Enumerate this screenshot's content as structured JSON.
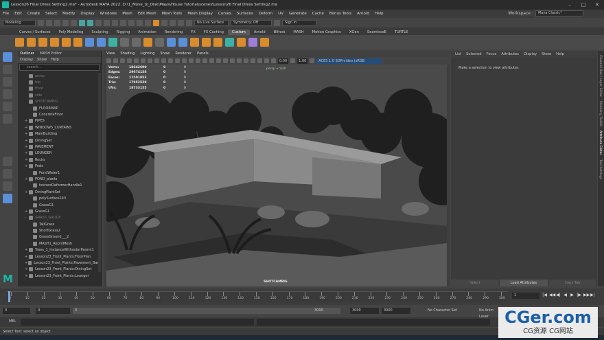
{
  "window": {
    "title": "Lesson26 Final Dress Setting2.ma* - Autodesk MAYA 2022: D:\\1_Move_to_Disk\\Maya\\House Tutorial\\scenes\\Lesson26 Final Dress Setting2.ma",
    "workspace_label": "Workspace :",
    "workspace_value": "Maya Classic*"
  },
  "menubar": [
    "File",
    "Edit",
    "Create",
    "Select",
    "Modify",
    "Display",
    "Windows",
    "Mesh",
    "Edit Mesh",
    "Mesh Tools",
    "Mesh Display",
    "Curves",
    "Surfaces",
    "Deform",
    "UV",
    "Generate",
    "Cache",
    "Bonus Tools",
    "Arnold",
    "Help"
  ],
  "statusline": {
    "mode": "Modeling",
    "live_surface": "No Live Surface",
    "symmetry": "Symmetry: Off",
    "sign_in": "Sign In"
  },
  "shelf_tabs": [
    "Curves / Surfaces",
    "Poly Modeling",
    "Sculpting",
    "Rigging",
    "Animation",
    "Rendering",
    "FX",
    "FX Caching",
    "Custom",
    "Arnold",
    "Bifrost",
    "MASH",
    "Motion Graphics",
    "XGen",
    "SeamlessE",
    "TURTLE"
  ],
  "shelf_active": "Custom",
  "outliner": {
    "tabs": [
      "Outliner",
      "MASH Editor"
    ],
    "menu": [
      "Display",
      "Show",
      "Help"
    ],
    "search_placeholder": "search...",
    "rows": [
      {
        "label": "persp",
        "dim": true,
        "exp": ""
      },
      {
        "label": "top",
        "dim": true,
        "exp": ""
      },
      {
        "label": "front",
        "dim": true,
        "exp": ""
      },
      {
        "label": "side",
        "dim": true,
        "exp": ""
      },
      {
        "label": "SHOTCAMBIG",
        "dim": true,
        "exp": ""
      },
      {
        "label": "FLOORMAP",
        "dim": false,
        "exp": ""
      },
      {
        "label": "ConcreteFloor",
        "dim": false,
        "exp": ""
      },
      {
        "label": "PIPES",
        "dim": false,
        "exp": "+"
      },
      {
        "label": "WINDOWS_CURTAINS",
        "dim": false,
        "exp": "+"
      },
      {
        "label": "MainBuilding",
        "dim": false,
        "exp": "+"
      },
      {
        "label": "DiningSet",
        "dim": false,
        "exp": "+"
      },
      {
        "label": "PAVEMENT",
        "dim": false,
        "exp": "+"
      },
      {
        "label": "LOUNGER",
        "dim": false,
        "exp": "+"
      },
      {
        "label": "Rocks",
        "dim": false,
        "exp": "+"
      },
      {
        "label": "Pods",
        "dim": false,
        "exp": "+"
      },
      {
        "label": "PondWater1",
        "dim": false,
        "exp": ""
      },
      {
        "label": "POND_plants",
        "dim": false,
        "exp": "+"
      },
      {
        "label": "textureDeformerHandle1",
        "dim": false,
        "exp": ""
      },
      {
        "label": "DiningPlantSet",
        "dim": false,
        "exp": "+"
      },
      {
        "label": "polySurface143",
        "dim": false,
        "exp": ""
      },
      {
        "label": "GrassG1",
        "dim": false,
        "exp": ""
      },
      {
        "label": "GrassG1",
        "dim": false,
        "exp": "+"
      },
      {
        "label": "GRASS_GROUP",
        "dim": true,
        "exp": "-"
      },
      {
        "label": "TallGrass",
        "dim": false,
        "exp": ""
      },
      {
        "label": "ShortGrass2",
        "dim": false,
        "exp": ""
      },
      {
        "label": "GrassGround___2",
        "dim": false,
        "exp": ""
      },
      {
        "label": "MASH1_ReproMesh",
        "dim": false,
        "exp": ""
      },
      {
        "label": "Trees_1_InstanceWithosterParent1",
        "dim": false,
        "exp": "+"
      },
      {
        "label": "Lesson23_Front_Plants:FloorPlan",
        "dim": false,
        "exp": "+"
      },
      {
        "label": "Lesson23_Front_Plants:Pavement_Bas",
        "dim": false,
        "exp": "+"
      },
      {
        "label": "Lesson23_Front_Plants:DiningSet",
        "dim": false,
        "exp": "+"
      },
      {
        "label": "Lesson23_Front_Plants:Lounger",
        "dim": false,
        "exp": "+"
      }
    ]
  },
  "viewport": {
    "menu": [
      "View",
      "Shading",
      "Lighting",
      "Show",
      "Renderer",
      "Panels"
    ],
    "exposure": "0.00",
    "gamma": "1.00",
    "color_space": "ACES 1.0 SDR-video (sRGB",
    "hud": [
      {
        "label": "Verts:",
        "v1": "18642600",
        "v2": "0",
        "v3": "0"
      },
      {
        "label": "Edges:",
        "v1": "29674158",
        "v2": "0",
        "v3": "0"
      },
      {
        "label": "Faces:",
        "v1": "11501853",
        "v2": "0",
        "v3": "0"
      },
      {
        "label": "Tris:",
        "v1": "17952520",
        "v2": "0",
        "v3": "0"
      },
      {
        "label": "UVs:",
        "v1": "18733155",
        "v2": "0",
        "v3": "0"
      }
    ],
    "persp_label": "persp + SDR",
    "camera_name": "SHOTCAMBIG"
  },
  "attribute_editor": {
    "menu": [
      "List",
      "Selected",
      "Focus",
      "Attributes",
      "Display",
      "Show",
      "Help"
    ],
    "message": "Make a selection to view attributes",
    "buttons": [
      "Select",
      "Load Attributes",
      "Copy Tab"
    ]
  },
  "side_tabs": [
    "Channel Box / Layer Editor",
    "Modeling Toolkit",
    "Attribute Editor",
    "Tool Settings"
  ],
  "timeline": {
    "ticks": [
      "0",
      "10",
      "20",
      "30",
      "40",
      "50",
      "60",
      "70",
      "80",
      "90",
      "100",
      "110",
      "120",
      "130",
      "140",
      "150",
      "160",
      "170",
      "180",
      "190",
      "200",
      "210",
      "220",
      "230",
      "240",
      "250",
      "260",
      "270",
      "280",
      "290",
      "300"
    ],
    "current_frame": "1",
    "play_glyphs": [
      "|◀",
      "◀◀",
      "◀|",
      "◀",
      "▶",
      "|▶",
      "▶▶",
      "▶|"
    ]
  },
  "range": {
    "start": "0",
    "playback_start": "0",
    "slider_label": "0",
    "playback_end": "3000",
    "end": "3000",
    "end2": "3000",
    "character_set": "No Character Set",
    "anim_layer": "No Anim Layer"
  },
  "mel_label": "MEL",
  "help_text": "Select Tool: select an object",
  "watermark": {
    "big": "CGer.com",
    "small": "CG资源 CG网站"
  }
}
